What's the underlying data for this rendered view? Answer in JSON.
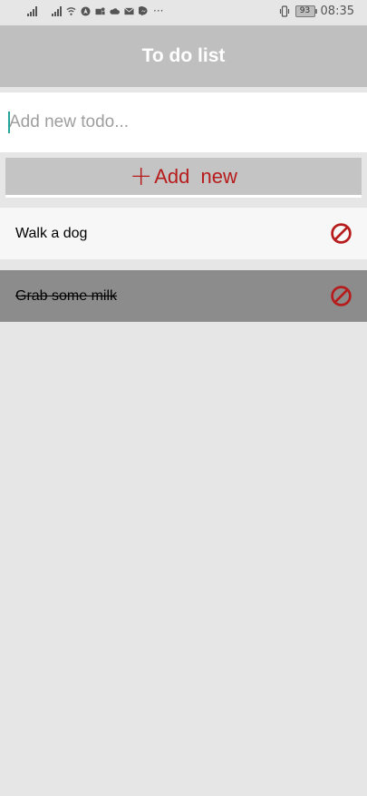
{
  "status_bar": {
    "battery_level": "93",
    "time": "08:35",
    "icons": [
      "signal-icon",
      "signal-icon",
      "wifi-icon",
      "nav-icon",
      "teams-icon",
      "cloud-icon",
      "mail-icon",
      "messenger-icon",
      "more-icon"
    ]
  },
  "header": {
    "title": "To do list",
    "background": "#bfbfbf"
  },
  "input": {
    "placeholder": "Add new todo...",
    "value": ""
  },
  "add_button": {
    "icon": "plus-icon",
    "label": "Add  new",
    "color": "#b71c1c"
  },
  "todos": [
    {
      "text": "Walk a dog",
      "done": false,
      "delete_icon": "block-icon"
    },
    {
      "text": "Grab some milk",
      "done": true,
      "delete_icon": "block-icon"
    }
  ],
  "colors": {
    "accent": "#b71c1c",
    "caret": "#26a69a",
    "page_background": "#e6e6e6",
    "done_row": "#8c8c8c"
  }
}
